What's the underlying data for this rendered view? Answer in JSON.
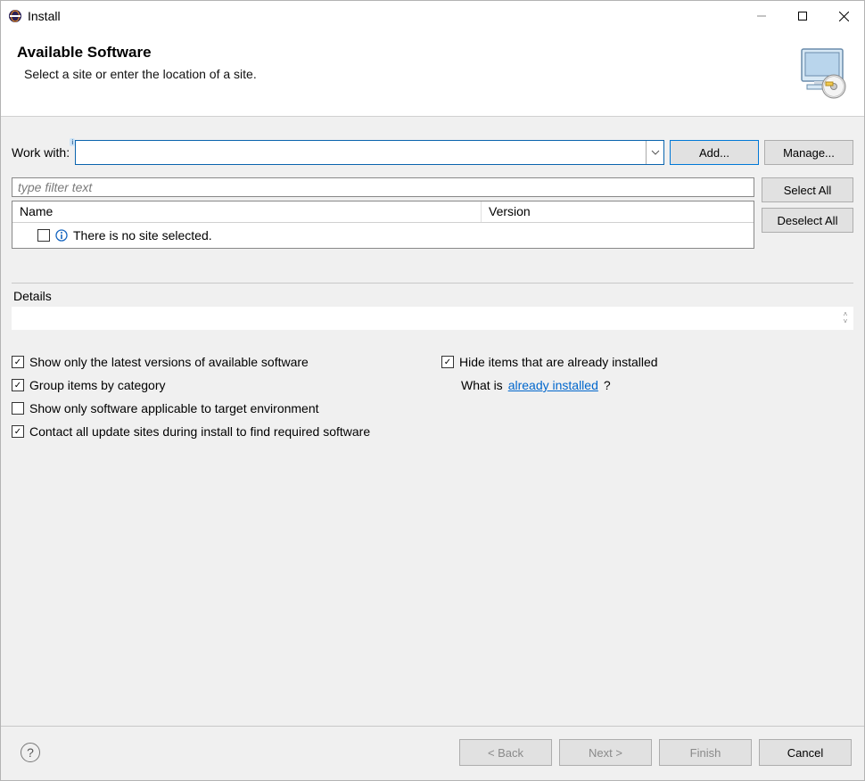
{
  "window": {
    "title": "Install"
  },
  "banner": {
    "heading": "Available Software",
    "subtitle": "Select a site or enter the location of a site."
  },
  "workwith": {
    "label": "Work with:",
    "value": "",
    "add_label": "Add...",
    "manage_label": "Manage..."
  },
  "filter": {
    "placeholder": "type filter text"
  },
  "columns": {
    "name": "Name",
    "version": "Version"
  },
  "empty_row": {
    "text": "There is no site selected."
  },
  "side_buttons": {
    "select_all": "Select All",
    "deselect_all": "Deselect All"
  },
  "details": {
    "label": "Details",
    "value": ""
  },
  "options": {
    "latest_versions": {
      "label": "Show only the latest versions of available software",
      "checked": true
    },
    "group_by_category": {
      "label": "Group items by category",
      "checked": true
    },
    "target_env": {
      "label": "Show only software applicable to target environment",
      "checked": false
    },
    "contact_sites": {
      "label": "Contact all update sites during install to find required software",
      "checked": true
    },
    "hide_installed": {
      "label": "Hide items that are already installed",
      "checked": true
    },
    "what_is_prefix": "What is ",
    "what_is_link": "already installed",
    "what_is_suffix": "?"
  },
  "footer": {
    "back": "< Back",
    "next": "Next >",
    "finish": "Finish",
    "cancel": "Cancel"
  }
}
